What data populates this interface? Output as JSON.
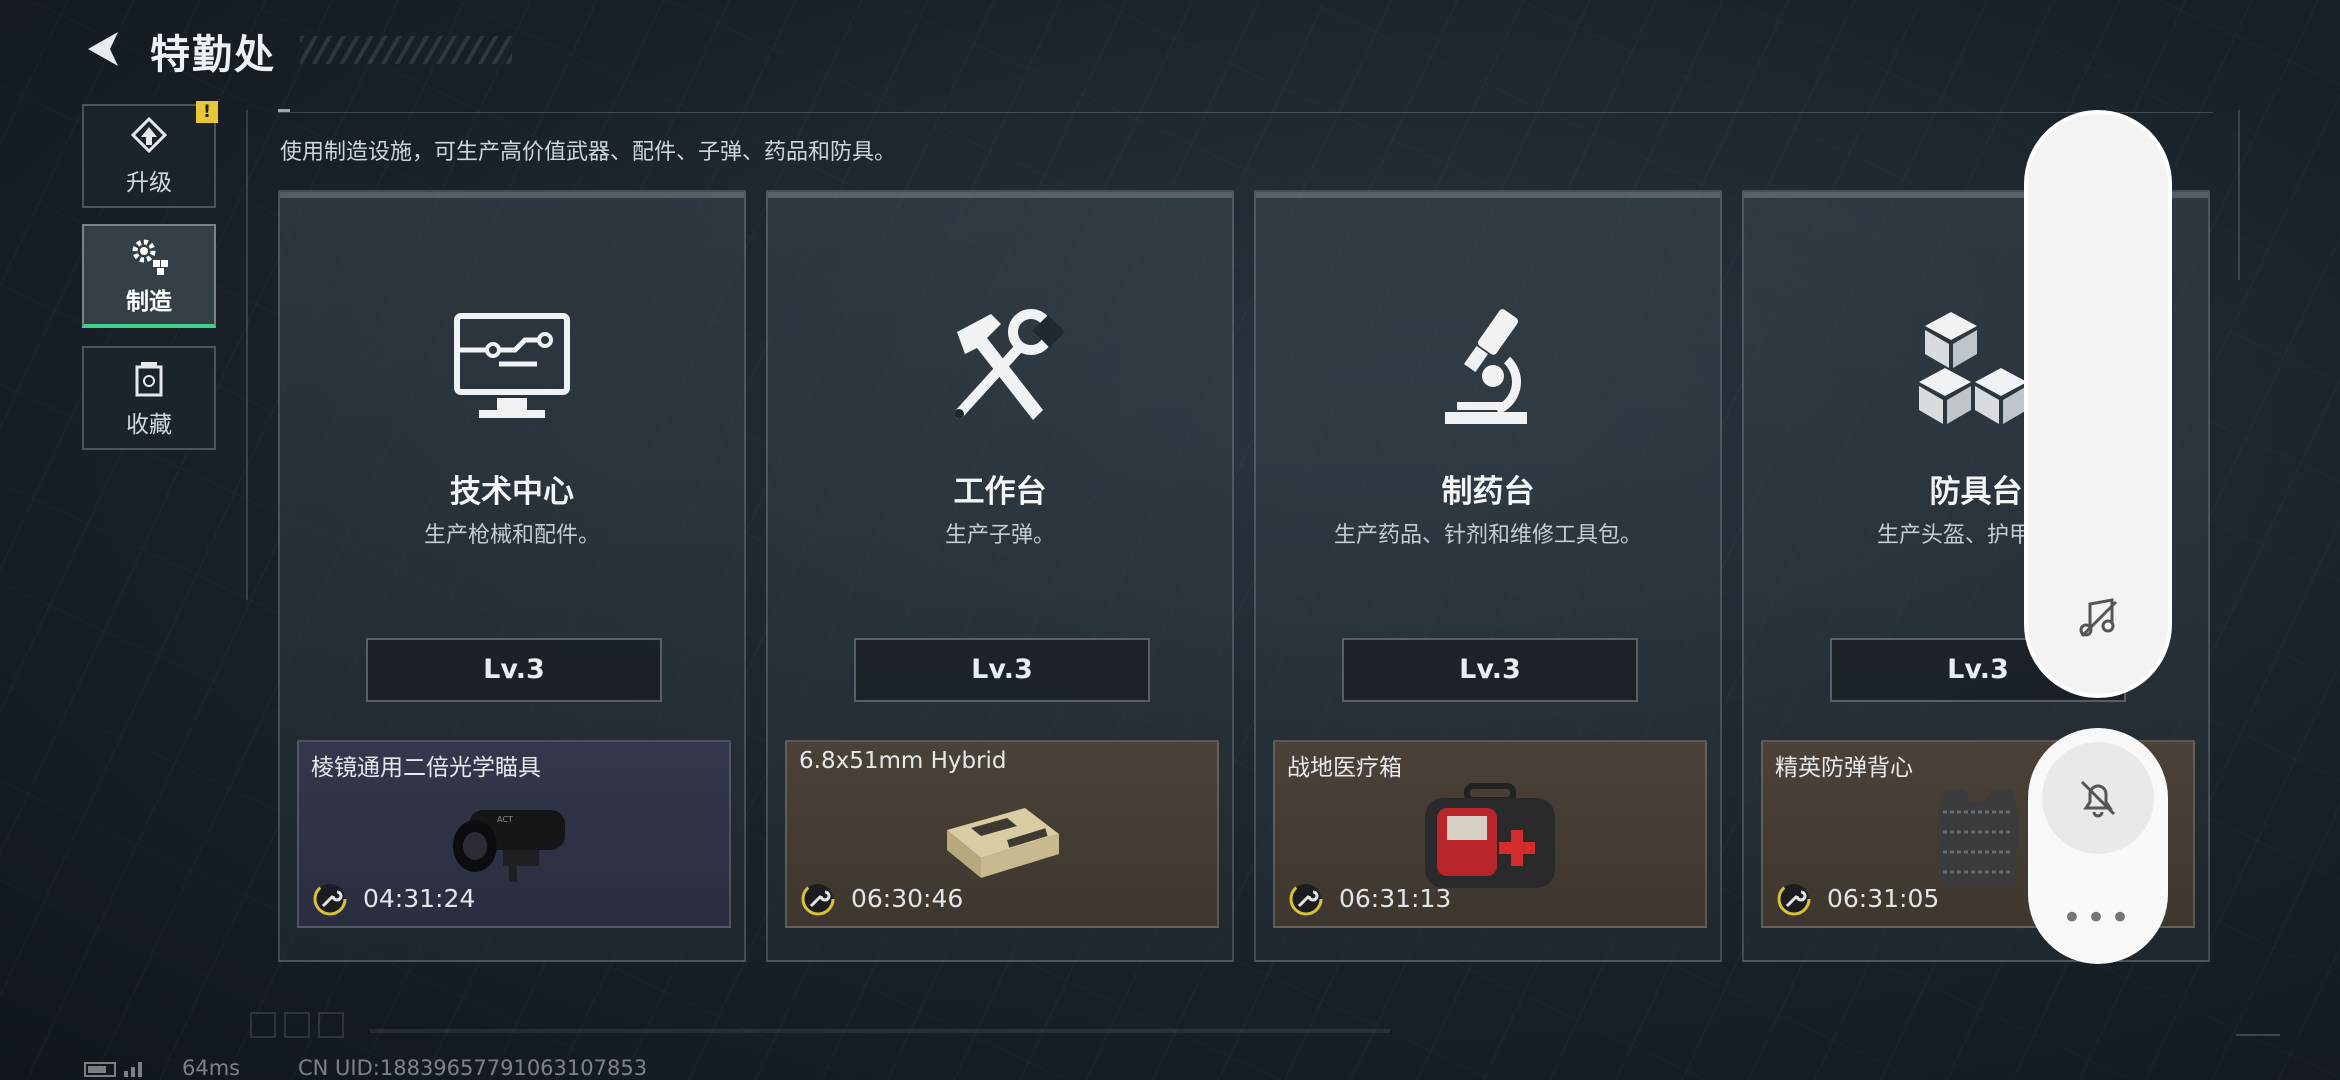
{
  "header": {
    "title": "特勤处"
  },
  "sidebar": {
    "items": [
      {
        "label": "升级",
        "icon": "upgrade-icon",
        "badge": "!"
      },
      {
        "label": "制造",
        "icon": "gear-blocks-icon",
        "active": true
      },
      {
        "label": "收藏",
        "icon": "collection-icon"
      }
    ]
  },
  "main": {
    "description": "使用制造设施，可生产高价值武器、配件、子弹、药品和防具。",
    "cards": [
      {
        "title": "技术中心",
        "subtitle": "生产枪械和配件。",
        "level": "Lv.3",
        "icon": "monitor-circuit-icon",
        "product": {
          "name": "棱镜通用二倍光学瞄具",
          "time": "04:31:24",
          "rarity": "purple",
          "image": "optic-scope-image"
        }
      },
      {
        "title": "工作台",
        "subtitle": "生产子弹。",
        "level": "Lv.3",
        "icon": "hammer-wrench-icon",
        "product": {
          "name": "6.8x51mm Hybrid",
          "time": "06:30:46",
          "rarity": "brown",
          "image": "ammo-box-image"
        }
      },
      {
        "title": "制药台",
        "subtitle": "生产药品、针剂和维修工具包。",
        "level": "Lv.3",
        "icon": "microscope-icon",
        "product": {
          "name": "战地医疗箱",
          "time": "06:31:13",
          "rarity": "brown",
          "image": "medkit-image"
        }
      },
      {
        "title": "防具台",
        "subtitle": "生产头盔、护甲、胸",
        "level": "Lv.3",
        "icon": "cubes-icon",
        "product": {
          "name": "精英防弹背心",
          "time": "06:31:05",
          "rarity": "brown",
          "image": "vest-image"
        }
      }
    ]
  },
  "overlay": {
    "top_icon": "music-off-icon",
    "bell_icon": "bell-off-icon",
    "more_label": "•••"
  },
  "footer": {
    "ping": "64ms",
    "uid": "CN UID:18839657791063107853"
  },
  "colors": {
    "accent_green": "#3fd08a",
    "badge_yellow": "#e8c63a",
    "purple_rarity": "#34374d",
    "brown_rarity": "#4a4238"
  }
}
